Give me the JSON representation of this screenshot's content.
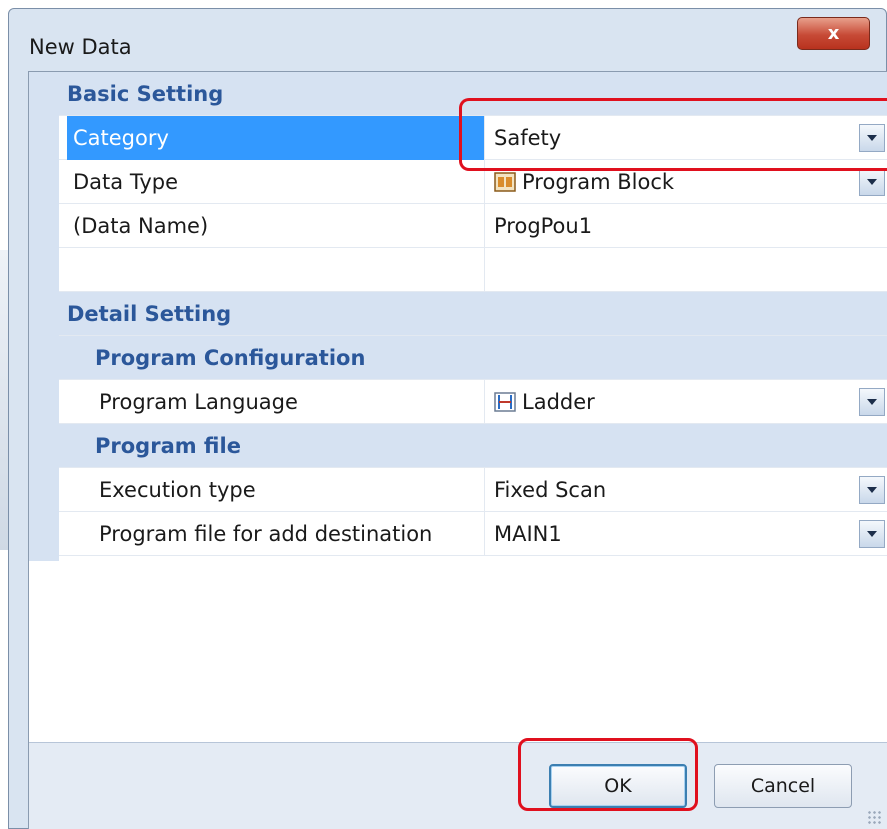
{
  "window": {
    "title": "New Data",
    "close_label": "x"
  },
  "sections": {
    "basic": "Basic Setting",
    "detail": "Detail Setting",
    "program_configuration": "Program Configuration",
    "program_file": "Program file"
  },
  "properties": {
    "category": {
      "label": "Category",
      "value": "Safety"
    },
    "data_type": {
      "label": "Data Type",
      "value": "Program Block",
      "icon": "program-block-icon"
    },
    "data_name": {
      "label": "(Data Name)",
      "value": "ProgPou1"
    },
    "program_language": {
      "label": "Program Language",
      "value": "Ladder",
      "icon": "ladder-icon"
    },
    "execution_type": {
      "label": "Execution type",
      "value": "Fixed Scan"
    },
    "program_file_dest": {
      "label": "Program file for add destination",
      "value": "MAIN1"
    }
  },
  "buttons": {
    "ok": "OK",
    "cancel": "Cancel"
  },
  "colors": {
    "selection": "#3399ff",
    "category_band": "#d6e2f2",
    "section_text": "#2b579a",
    "annotation": "#e0101e"
  }
}
